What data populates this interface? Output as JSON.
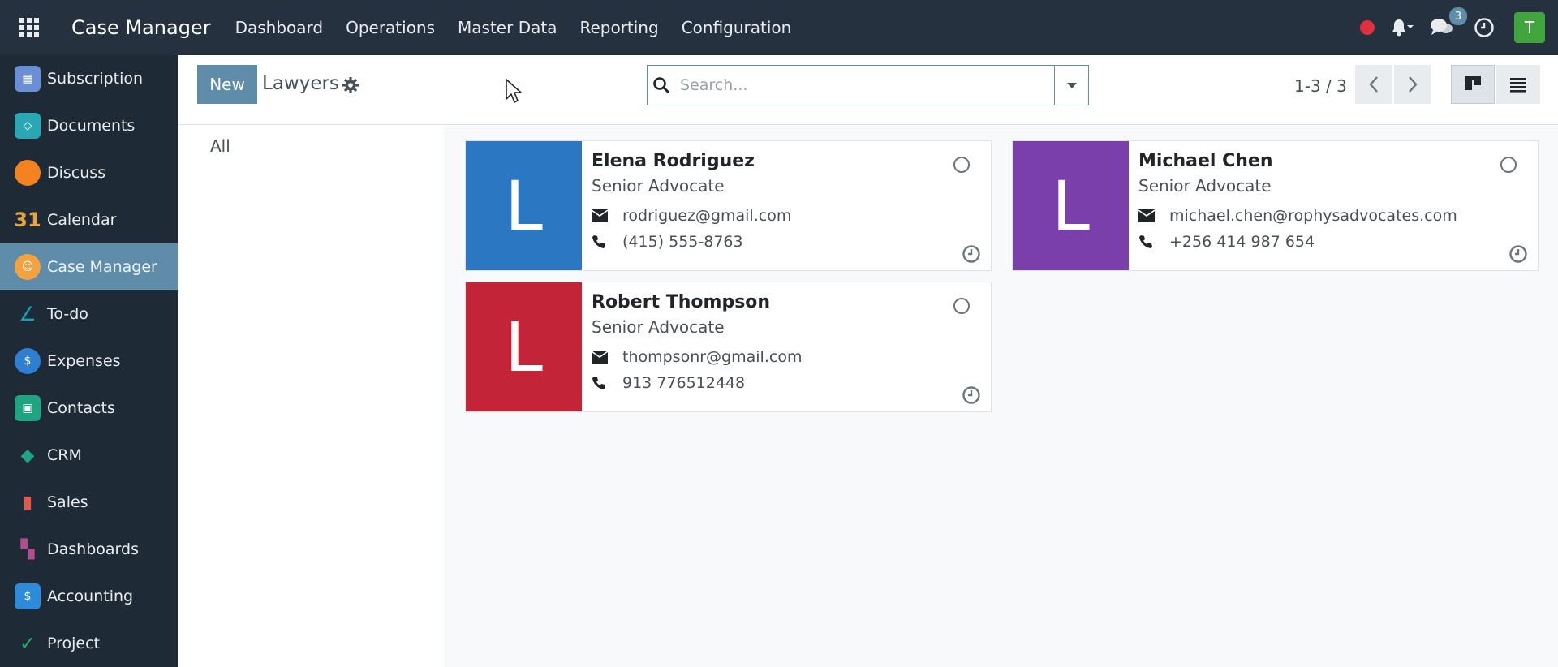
{
  "topbar": {
    "app_title": "Case Manager",
    "menu": [
      "Dashboard",
      "Operations",
      "Master Data",
      "Reporting",
      "Configuration"
    ],
    "chat_count": "3",
    "avatar_initial": "T",
    "colors": {
      "bar": "#25313f",
      "recording": "#e0303e",
      "avatar": "#3fa53c",
      "badge": "#5f8ca8"
    }
  },
  "sidebar": {
    "items": [
      {
        "label": "Subscription",
        "icon": "subscription-icon",
        "color": "#6a8fd6"
      },
      {
        "label": "Documents",
        "icon": "documents-icon",
        "color": "#2aa7b5"
      },
      {
        "label": "Discuss",
        "icon": "discuss-icon",
        "color": "#f58220"
      },
      {
        "label": "Calendar",
        "icon": "calendar-icon",
        "color": "#e8a33a"
      },
      {
        "label": "Case Manager",
        "icon": "case-manager-icon",
        "color": "#f4a240",
        "active": true
      },
      {
        "label": "To-do",
        "icon": "todo-icon",
        "color": "#17a2b8"
      },
      {
        "label": "Expenses",
        "icon": "expenses-icon",
        "color": "#2f7fd1"
      },
      {
        "label": "Contacts",
        "icon": "contacts-icon",
        "color": "#1fa481"
      },
      {
        "label": "CRM",
        "icon": "crm-icon",
        "color": "#20a38a"
      },
      {
        "label": "Sales",
        "icon": "sales-icon",
        "color": "#e05a4b"
      },
      {
        "label": "Dashboards",
        "icon": "dashboards-icon",
        "color": "#b04e8f"
      },
      {
        "label": "Accounting",
        "icon": "accounting-icon",
        "color": "#2d8bd9"
      },
      {
        "label": "Project",
        "icon": "project-icon",
        "color": "#27ae60"
      }
    ]
  },
  "control": {
    "new_label": "New",
    "title": "Lawyers",
    "search_placeholder": "Search...",
    "pager": "1-3 / 3"
  },
  "filters": {
    "all_label": "All"
  },
  "cards": [
    {
      "initial": "L",
      "color": "#2b77c2",
      "name": "Elena Rodriguez",
      "role": "Senior Advocate",
      "email": "rodriguez@gmail.com",
      "phone": " (415) 555-8763"
    },
    {
      "initial": "L",
      "color": "#7b3fab",
      "name": "Michael Chen",
      "role": "Senior Advocate",
      "email": "michael.chen@rophysadvocates.com",
      "phone": "+256 414 987 654"
    },
    {
      "initial": "L",
      "color": "#c32438",
      "name": "Robert Thompson",
      "role": "Senior Advocate",
      "email": "thompsonr@gmail.com",
      "phone": "913 776512448"
    }
  ]
}
